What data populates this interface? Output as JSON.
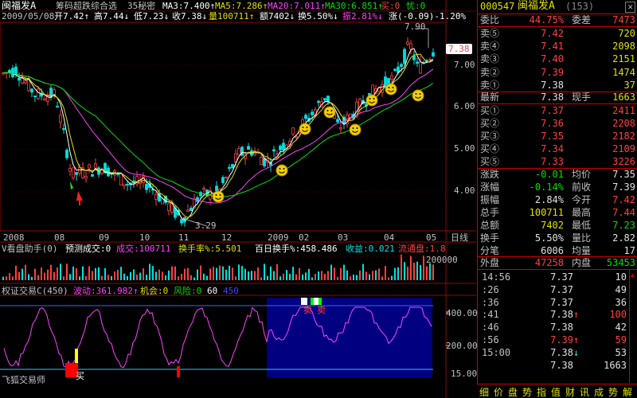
{
  "header": {
    "stock_name": "闽福发A",
    "indicator_title": "筹码超跌综合选",
    "indicator_param": "35秘密",
    "ma3": "MA3:7.400↑",
    "ma5": "MA5:7.286↑",
    "ma20": "MA20:7.011↑",
    "ma30": "MA30:6.851↑",
    "buy": "买:0",
    "sell": "忧:0"
  },
  "info_line": {
    "date": "2009/05/08",
    "open": "开7.42↑",
    "high": "高7.44↓",
    "low": "低7.23↓",
    "close": "收7.38↓",
    "volume": "量100711↑",
    "amount": "额7402↓",
    "turnover": "换5.50%↓",
    "amplitude": "振2.81%↓",
    "change": "涨(-0.09)-1.20%"
  },
  "price_axis": [
    "7.00",
    "6.00",
    "5.00",
    "4.00"
  ],
  "high_label": "7.90",
  "low_label": "3.29",
  "current_price_tag": "7.38",
  "x_axis": [
    "2008",
    "08",
    "09",
    "10",
    "11",
    "12",
    "2009",
    "02",
    "03",
    "04",
    "05"
  ],
  "period_label": "日线",
  "volume_panel": {
    "title": "V看盘助手(0)",
    "forecast": "预测成交:0",
    "volume": "成交:100711",
    "turnover": "换手率%:5.501",
    "hundred_day": "百日换手%:458.486",
    "profit": "收益:0.021",
    "float_cap": "流通盘:1.8",
    "axis_label": "200000"
  },
  "osc_panel": {
    "title": "权证交易C(450)",
    "wave": "波动:361.982↑",
    "chance": "机会:0",
    "risk": "风险:0",
    "v60": "60",
    "v450": "450",
    "axis": [
      "400.00",
      "200.00",
      "15.00"
    ],
    "sell_label": "卖",
    "buy_label": "买",
    "footer": "飞狐交易师"
  },
  "panel": {
    "code": "000547",
    "name": "闽福发A",
    "sub": "(153)",
    "webi_label": "委比",
    "webi_value": "44.75%",
    "wecha_label": "委差",
    "wecha_value": "7473",
    "asks": [
      {
        "label": "卖⑤",
        "price": "7.42",
        "vol": "720"
      },
      {
        "label": "卖④",
        "price": "7.41",
        "vol": "2098"
      },
      {
        "label": "卖③",
        "price": "7.40",
        "vol": "2151"
      },
      {
        "label": "卖②",
        "price": "7.39",
        "vol": "1474"
      },
      {
        "label": "卖①",
        "price": "7.38",
        "vol": "37"
      }
    ],
    "last_label": "最新",
    "last_price": "7.38",
    "hand_label": "现手",
    "hand_value": "1663",
    "bids": [
      {
        "label": "买①",
        "price": "7.37",
        "vol": "2411"
      },
      {
        "label": "买②",
        "price": "7.36",
        "vol": "2208"
      },
      {
        "label": "买③",
        "price": "7.35",
        "vol": "2182"
      },
      {
        "label": "买④",
        "price": "7.34",
        "vol": "2109"
      },
      {
        "label": "买⑤",
        "price": "7.33",
        "vol": "3226"
      }
    ],
    "stats": [
      {
        "l1": "涨跌",
        "v1": "-0.01",
        "c1": "green",
        "l2": "均价",
        "v2": "7.35",
        "c2": "white"
      },
      {
        "l1": "涨幅",
        "v1": "-0.14%",
        "c1": "green",
        "l2": "前收",
        "v2": "7.39",
        "c2": "white"
      },
      {
        "l1": "振幅",
        "v1": "2.84%",
        "c1": "white",
        "l2": "今开",
        "v2": "7.42",
        "c2": "red"
      },
      {
        "l1": "总手",
        "v1": "100711",
        "c1": "yellow",
        "l2": "最高",
        "v2": "7.44",
        "c2": "red"
      },
      {
        "l1": "总额",
        "v1": "7402",
        "c1": "yellow",
        "l2": "最低",
        "v2": "7.23",
        "c2": "green"
      },
      {
        "l1": "换手",
        "v1": "5.50%",
        "c1": "white",
        "l2": "量比",
        "v2": "2.82",
        "c2": "white"
      },
      {
        "l1": "分笔",
        "v1": "6006",
        "c1": "white",
        "l2": "均量",
        "v2": "17",
        "c2": "white"
      }
    ],
    "outer_label": "外盘",
    "outer_value": "47258",
    "inner_label": "内盘",
    "inner_value": "53453",
    "ticks": [
      {
        "time": "14:56",
        "price": "7.37",
        "arrow": "",
        "vol": "10",
        "pc": "white",
        "vc": "white"
      },
      {
        "time": ":26",
        "price": "7.37",
        "arrow": "",
        "vol": "49",
        "pc": "white",
        "vc": "white"
      },
      {
        "time": ":36",
        "price": "7.37",
        "arrow": "",
        "vol": "36",
        "pc": "white",
        "vc": "white"
      },
      {
        "time": ":41",
        "price": "7.38",
        "arrow": "↑",
        "vol": "100",
        "pc": "white",
        "vc": "red"
      },
      {
        "time": ":46",
        "price": "7.38",
        "arrow": "",
        "vol": "42",
        "pc": "white",
        "vc": "white"
      },
      {
        "time": ":56",
        "price": "7.39",
        "arrow": "↑",
        "vol": "59",
        "pc": "red",
        "vc": "red"
      },
      {
        "time": "15:00",
        "price": "7.38",
        "arrow": "↓",
        "vol": "53",
        "pc": "white",
        "vc": "white"
      },
      {
        "time": "",
        "price": "7.38",
        "arrow": "",
        "vol": "1663",
        "pc": "white",
        "vc": "white"
      }
    ],
    "tabs": [
      "细",
      "价",
      "盘",
      "势",
      "指",
      "值",
      "财",
      "讯",
      "成",
      "势",
      "解"
    ]
  },
  "colors": {
    "up": "#ff4040",
    "down": "#00e0e0",
    "ma3": "#ffffff",
    "ma5": "#e0e000",
    "ma20": "#ff40ff",
    "ma30": "#00e000",
    "wave": "#ff40ff"
  }
}
